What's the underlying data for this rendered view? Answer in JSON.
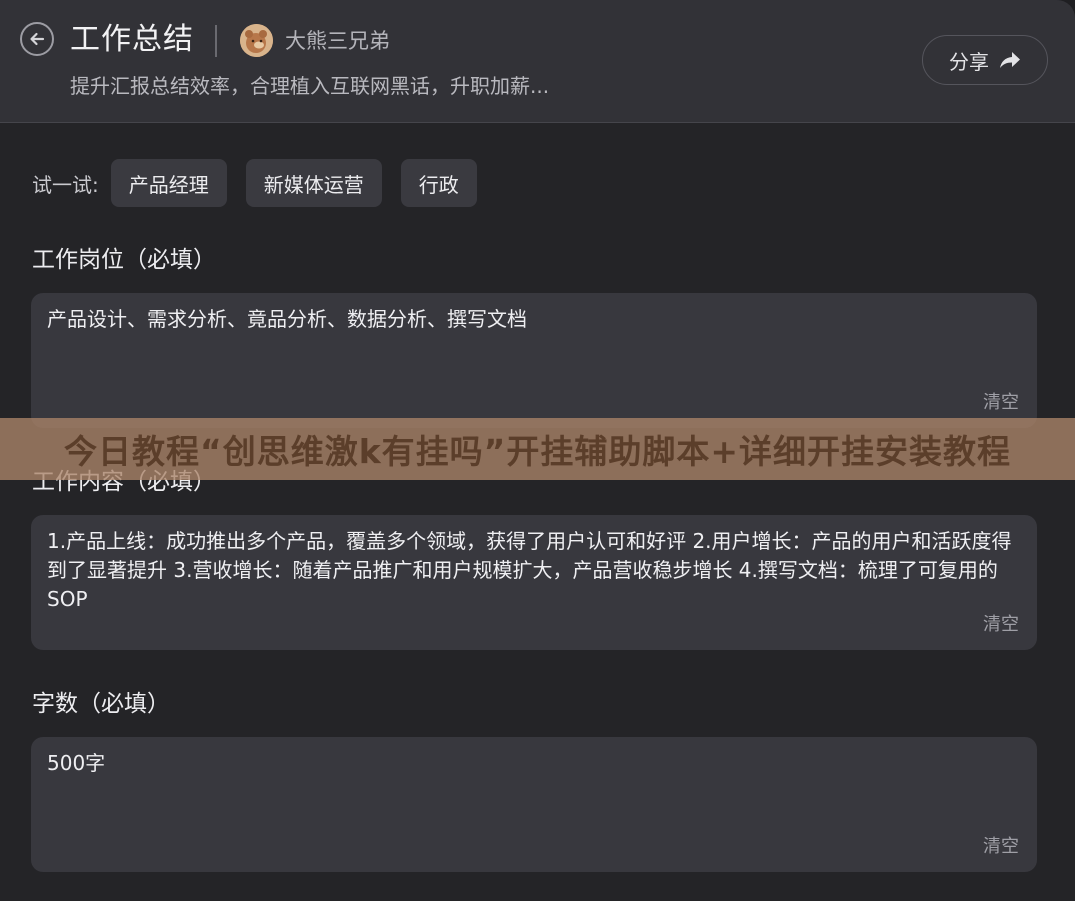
{
  "header": {
    "title": "工作总结",
    "author": "大熊三兄弟",
    "subtitle": "提升汇报总结效率，合理植入互联网黑话，升职加薪...",
    "share_label": "分享"
  },
  "try": {
    "label": "试一试:",
    "chips": [
      "产品经理",
      "新媒体运营",
      "行政"
    ]
  },
  "fields": {
    "position": {
      "label": "工作岗位（必填）",
      "value": "产品设计、需求分析、竟品分析、数据分析、撰写文档",
      "clear_label": "清空"
    },
    "content": {
      "label": "工作内容（必填）",
      "value": "1.产品上线：成功推出多个产品，覆盖多个领域，获得了用户认可和好评 2.用户增长：产品的用户和活跃度得到了显著提升 3.营收增长：随着产品推广和用户规模扩大，产品营收稳步增长 4.撰写文档：梳理了可复用的SOP",
      "clear_label": "清空"
    },
    "wordcount": {
      "label": "字数（必填）",
      "value": "500字",
      "clear_label": "清空"
    }
  },
  "banner": {
    "text": "今日教程“创思维激k有挂吗”开挂辅助脚本+详细开挂安装教程"
  },
  "colors": {
    "background": "#242427",
    "header": "#323237",
    "field": "#38383e",
    "chip": "#3a3a40",
    "banner": "#aa8469"
  }
}
